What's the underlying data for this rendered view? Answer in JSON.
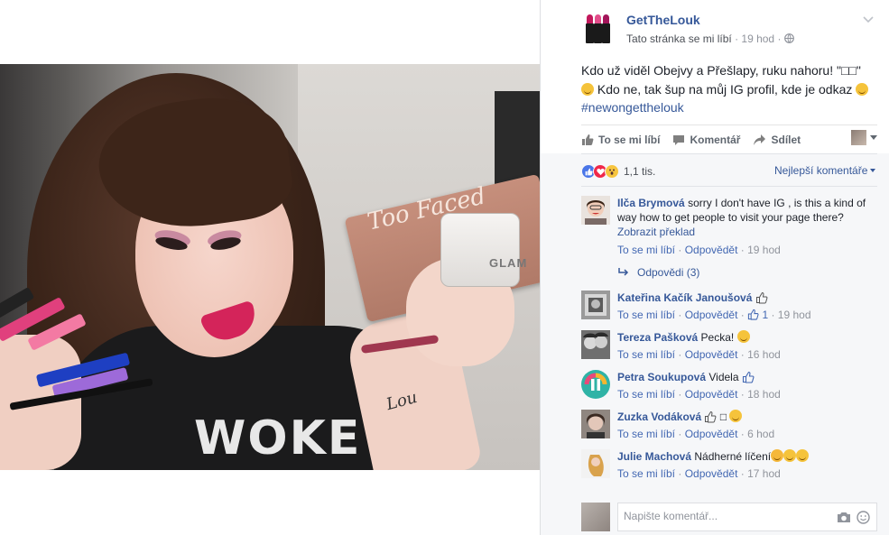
{
  "post": {
    "page_name": "GetTheLouk",
    "meta_liked": "Tato stránka se mi líbí",
    "meta_sep": "·",
    "meta_time": "19 hod",
    "meta_sep2": "·",
    "text_part1": "Kdo už viděl Obejvy a Přešlapy, ruku nahoru! \"□□\"",
    "text_part2": "Kdo ne, tak šup na můj IG profil, kde je odkaz",
    "hashtag": "#newongetthelouk"
  },
  "photo": {
    "palette_brand": "Too Faced",
    "jar_label": "GLAM",
    "shirt_text": "WOKE",
    "tattoo": "Lou"
  },
  "actions": {
    "like": "To se mi líbí",
    "comment": "Komentář",
    "share": "Sdílet"
  },
  "reactions": {
    "count": "1,1 tis.",
    "sort": "Nejlepší komentáře"
  },
  "comments": [
    {
      "author": "Ilča Brymová",
      "text": "sorry I don't have IG , is this a kind of way how to get people to visit your page there?",
      "translate": "Zobrazit překlad",
      "like": "To se mi líbí",
      "reply": "Odpovědět",
      "time": "19 hod",
      "replies_label": "Odpovědi (3)"
    },
    {
      "author": "Kateřina Kačík Janoušová",
      "text": "",
      "like": "To se mi líbí",
      "reply": "Odpovědět",
      "likes": "1",
      "time": "19 hod"
    },
    {
      "author": "Tereza Pašková",
      "text": "Pecka!",
      "like": "To se mi líbí",
      "reply": "Odpovědět",
      "time": "16 hod"
    },
    {
      "author": "Petra Soukupová",
      "text": "Videla",
      "like": "To se mi líbí",
      "reply": "Odpovědět",
      "time": "18 hod"
    },
    {
      "author": "Zuzka Vodáková",
      "text": "□",
      "like": "To se mi líbí",
      "reply": "Odpovědět",
      "time": "6 hod"
    },
    {
      "author": "Julie Machová",
      "text": "Nádherné líčení",
      "like": "To se mi líbí",
      "reply": "Odpovědět",
      "time": "17 hod"
    }
  ],
  "composer": {
    "placeholder": "Napište komentář..."
  },
  "colors": {
    "link": "#365899",
    "meta": "#90949c",
    "like_blue": "#4a76e8",
    "love_red": "#f0284a"
  }
}
